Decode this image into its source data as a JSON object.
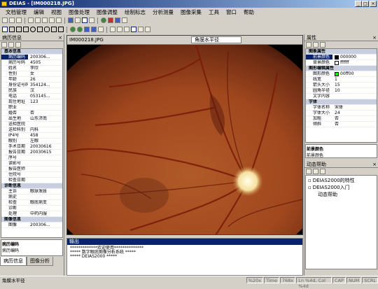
{
  "window": {
    "title": "DEIAS - [IM000218.JPG]"
  },
  "menu": [
    "文档管理",
    "编辑",
    "视图",
    "图像处理",
    "图像调整",
    "绘制标志",
    "分析测量",
    "图像采集",
    "工具",
    "窗口",
    "帮助"
  ],
  "left_panel": {
    "title": "病历信息",
    "groups": [
      {
        "name": "基本信息",
        "rows": [
          [
            "病历编码",
            "200306..."
          ],
          [
            "病历号码",
            "4505"
          ],
          [
            "姓名",
            "李欣"
          ],
          [
            "性别",
            "女"
          ],
          [
            "年龄",
            "26"
          ],
          [
            "身份证号码",
            "354124..."
          ],
          [
            "民族",
            "汉"
          ],
          [
            "电话",
            "053145..."
          ],
          [
            "现住地址",
            "123"
          ],
          [
            "职业",
            ""
          ],
          [
            "婚否",
            "否"
          ],
          [
            "出生地",
            "山东济南"
          ],
          [
            "送检医院",
            ""
          ],
          [
            "送检科别",
            "内科"
          ],
          [
            "IP4号",
            "458"
          ],
          [
            "眼别",
            "左眼"
          ],
          [
            "手术日期",
            "20030616"
          ],
          [
            "报告日期",
            "20030615"
          ],
          [
            "序号",
            ""
          ],
          [
            "读影号",
            ""
          ],
          [
            "报告医师",
            ""
          ],
          [
            "住院号",
            ""
          ],
          [
            "检查日期",
            ""
          ]
        ]
      },
      {
        "name": "诊断信息",
        "rows": [
          [
            "主诉",
            "眼球发胀"
          ],
          [
            "病史",
            ""
          ],
          [
            "检查",
            "眼底病变"
          ],
          [
            "诊断",
            ""
          ],
          [
            "处理",
            "中药内服"
          ]
        ]
      },
      {
        "name": "图像信息",
        "rows": [
          [
            "图像",
            "200306..."
          ]
        ]
      }
    ],
    "desc_title": "病历编码",
    "desc_text": "病历编码",
    "tabs": [
      "病历信息",
      "图像分析"
    ]
  },
  "image_window": {
    "title": "IM000218.JPG",
    "combo": "角膜水平径"
  },
  "output": {
    "title": "输出",
    "lines": [
      "*************欢迎使用**************",
      "***** 数字眼底图像分析系统 *****",
      "*****        DEIAS2000       *****"
    ]
  },
  "props": {
    "title": "属性",
    "groups": [
      {
        "name": "图象属性",
        "rows": [
          [
            "前景颜色",
            "000000",
            "#000000"
          ],
          [
            "背景颜色",
            "ffffff",
            "#ffffff"
          ]
        ]
      },
      {
        "name": "图形编辑属性",
        "rows": [
          [
            "图形颜色",
            "00ff00",
            "#00ff00"
          ],
          [
            "线宽",
            "1",
            null
          ],
          [
            "箭头大小",
            "15",
            null
          ],
          [
            "圆角半径",
            "10",
            null
          ],
          [
            "文字内容",
            "",
            null
          ]
        ]
      },
      {
        "name": "字体",
        "rows": [
          [
            "字体名称",
            "宋体",
            null
          ],
          [
            "字体大小",
            "24",
            null
          ],
          [
            "加粗",
            "否",
            null
          ],
          [
            "倾斜",
            "否",
            null
          ]
        ]
      }
    ],
    "desc_title": "前景颜色",
    "desc_text": "前景颜色"
  },
  "help": {
    "title": "动态帮助",
    "items": [
      "DEIAS2000的特性",
      "DEIAS2000入门",
      "动态帮助"
    ]
  },
  "status": {
    "text": "角膜水平径",
    "cells": [
      "%20x",
      "Time",
      "768x",
      "Ln %4d, Col %4d",
      "CAP",
      "NUM",
      "SCRL"
    ]
  }
}
